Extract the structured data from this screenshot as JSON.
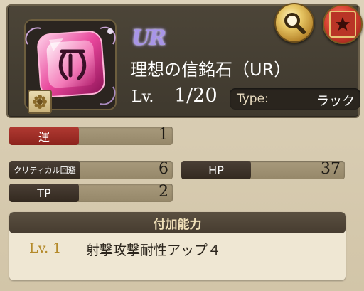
{
  "item": {
    "rarity": "UR",
    "name": "理想の信銘石（UR）",
    "level_label": "Lv.",
    "level_value": "1/20",
    "type_label": "Type:",
    "type_value": "ラック"
  },
  "buttons": {
    "search_icon": "magnifier-icon",
    "favorite_icon": "star-icon"
  },
  "stats": {
    "luck": {
      "label": "運",
      "value": "1"
    },
    "critical_evade": {
      "label": "クリティカル回避",
      "value": "6"
    },
    "hp": {
      "label": "HP",
      "value": "37"
    },
    "tp": {
      "label": "TP",
      "value": "2"
    }
  },
  "ability": {
    "header": "付加能力",
    "level": "Lv. 1",
    "name": "射撃攻撃耐性アップ４"
  },
  "colors": {
    "accent_red": "#b13a32",
    "accent_gold": "#b48a2a",
    "gem_pink": "#e8469b",
    "rarity_purple": "#a895e8"
  }
}
